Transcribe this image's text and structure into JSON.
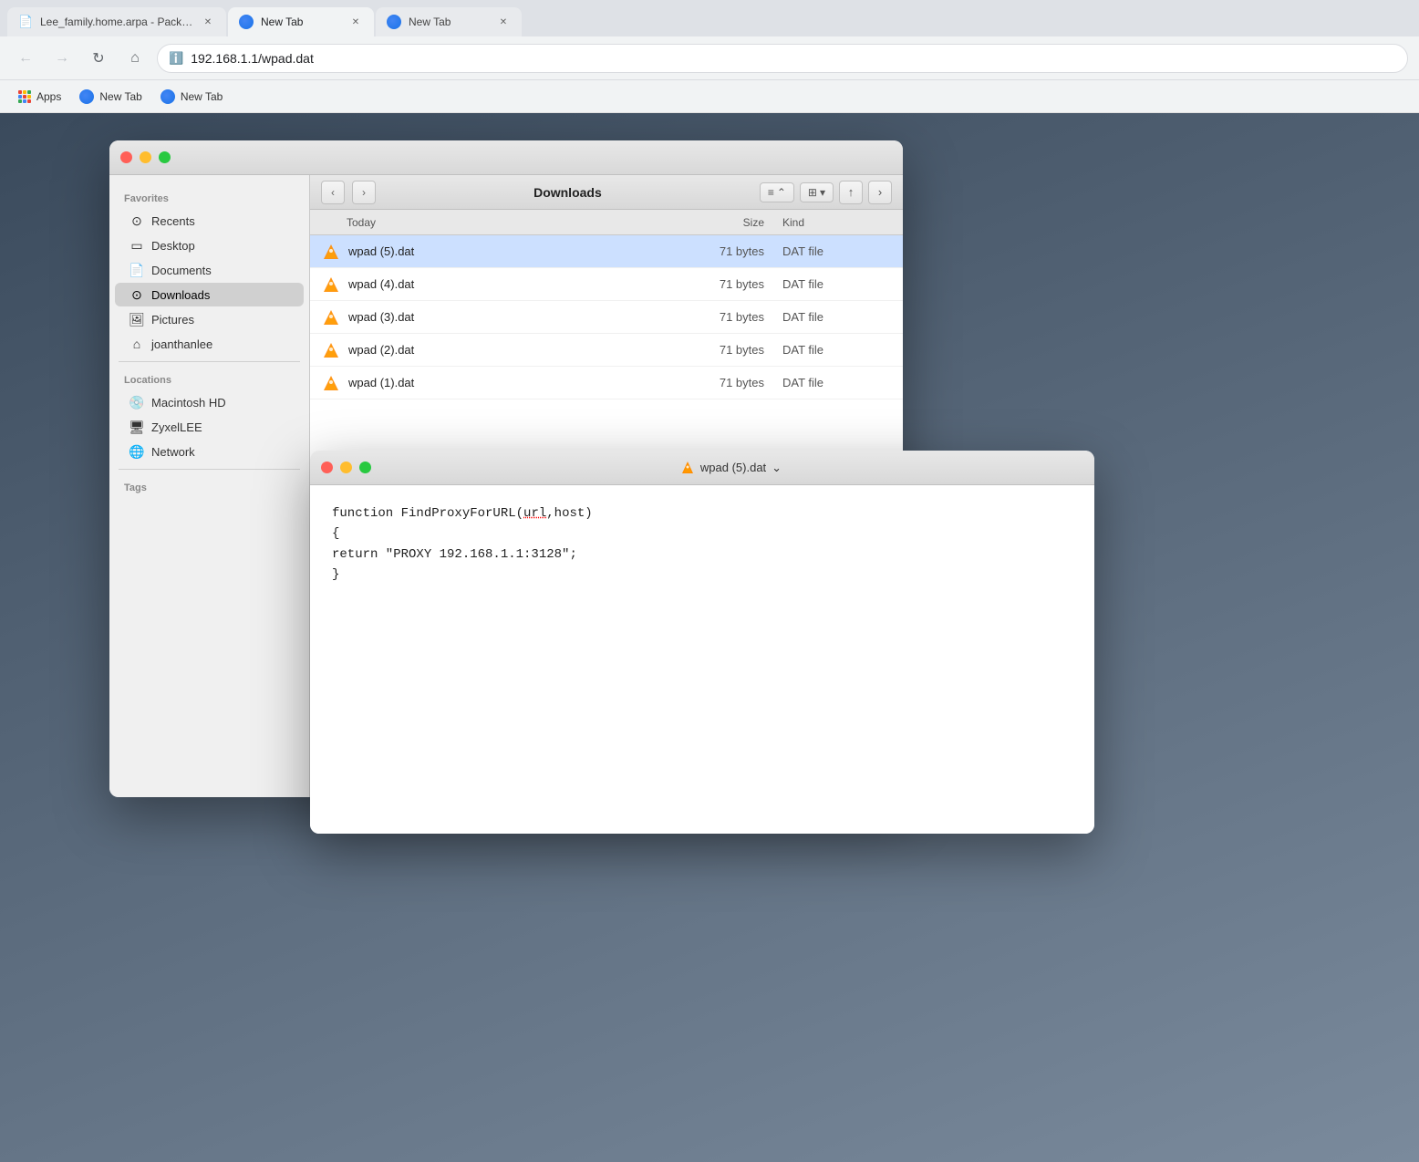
{
  "browser": {
    "tabs": [
      {
        "id": "tab1",
        "title": "Lee_family.home.arpa - Packa...",
        "favicon": "page",
        "active": false
      },
      {
        "id": "tab2",
        "title": "New Tab",
        "favicon": "globe",
        "active": true
      },
      {
        "id": "tab3",
        "title": "New Tab",
        "favicon": "globe",
        "active": false
      }
    ],
    "address": "192.168.1.1/wpad.dat",
    "bookmarks": [
      {
        "label": "Apps",
        "icon": "apps"
      },
      {
        "label": "New Tab",
        "icon": "globe"
      }
    ]
  },
  "finder": {
    "title": "Downloads",
    "sidebar": {
      "favorites_label": "Favorites",
      "favorites": [
        {
          "id": "recents",
          "label": "Recents",
          "icon": "clock"
        },
        {
          "id": "desktop",
          "label": "Desktop",
          "icon": "desktop"
        },
        {
          "id": "documents",
          "label": "Documents",
          "icon": "document"
        },
        {
          "id": "downloads",
          "label": "Downloads",
          "icon": "download",
          "active": true
        },
        {
          "id": "pictures",
          "label": "Pictures",
          "icon": "picture"
        },
        {
          "id": "joanthanlee",
          "label": "joanthanlee",
          "icon": "home"
        }
      ],
      "locations_label": "Locations",
      "locations": [
        {
          "id": "macintosh-hd",
          "label": "Macintosh HD",
          "icon": "hd"
        },
        {
          "id": "zyxellee",
          "label": "ZyxelLEE",
          "icon": "monitor"
        },
        {
          "id": "network",
          "label": "Network",
          "icon": "network"
        }
      ],
      "tags_label": "Tags"
    },
    "columns": {
      "name": "Today",
      "size": "Size",
      "kind": "Kind"
    },
    "files": [
      {
        "name": "wpad (5).dat",
        "size": "71 bytes",
        "kind": "DAT file",
        "selected": true
      },
      {
        "name": "wpad (4).dat",
        "size": "71 bytes",
        "kind": "DAT file",
        "selected": false
      },
      {
        "name": "wpad (3).dat",
        "size": "71 bytes",
        "kind": "DAT file",
        "selected": false
      },
      {
        "name": "wpad (2).dat",
        "size": "71 bytes",
        "kind": "DAT file",
        "selected": false
      },
      {
        "name": "wpad (1).dat",
        "size": "71 bytes",
        "kind": "DAT file",
        "selected": false
      }
    ]
  },
  "text_editor": {
    "title": "wpad (5).dat",
    "title_dropdown_icon": "chevron-down",
    "content_lines": [
      "function FindProxyForURL(url,host)",
      "{",
      "return \"PROXY 192.168.1.1:3128\";",
      "}"
    ],
    "underlined_word": "url"
  }
}
